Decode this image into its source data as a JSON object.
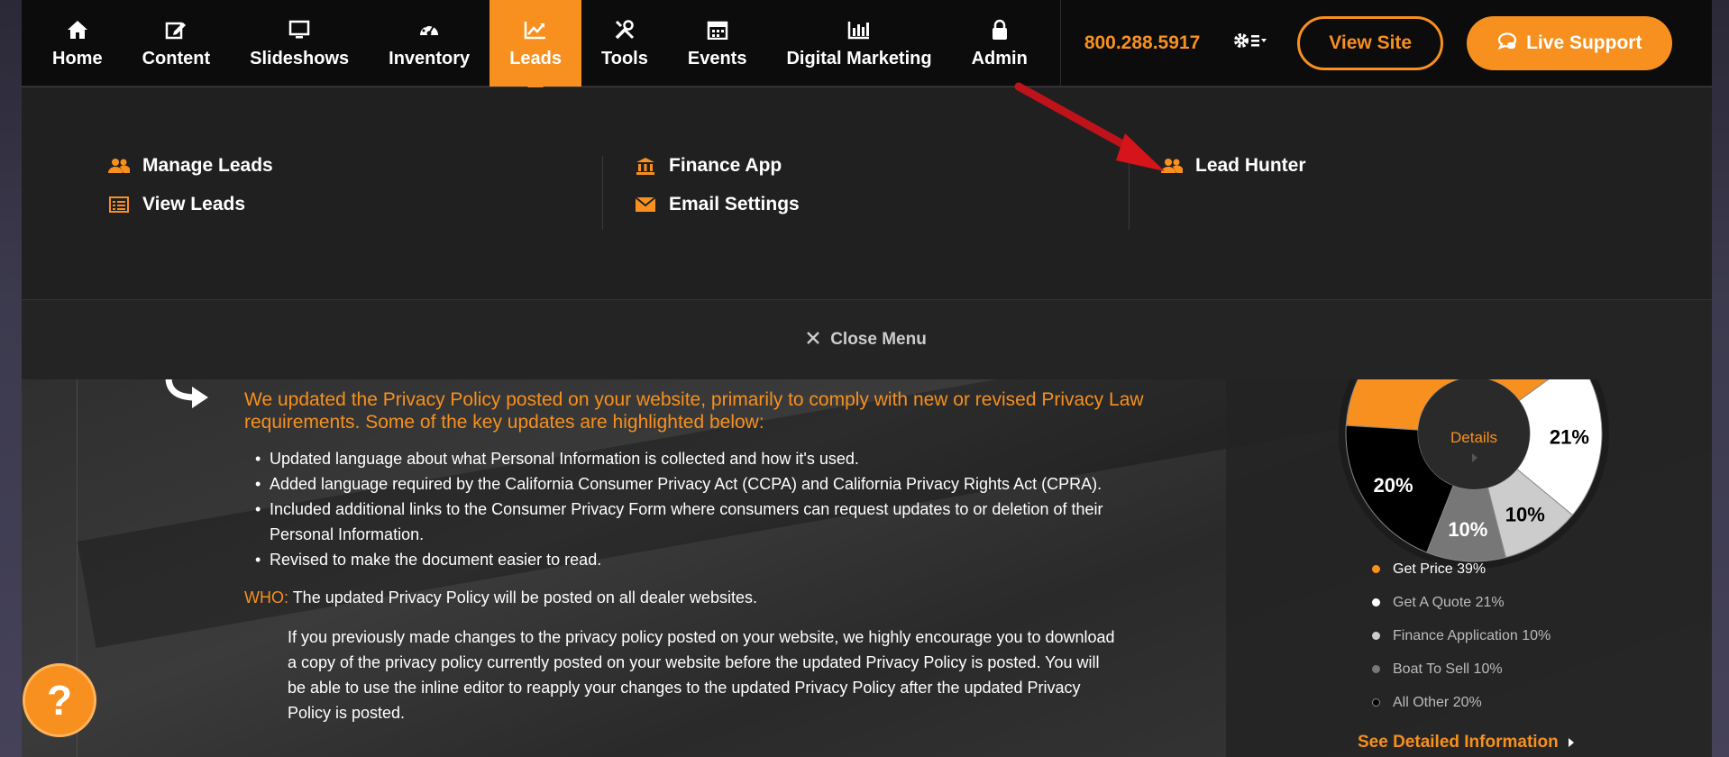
{
  "nav": {
    "items": [
      {
        "label": "Home",
        "icon": "home-icon"
      },
      {
        "label": "Content",
        "icon": "edit-icon"
      },
      {
        "label": "Slideshows",
        "icon": "monitor-icon"
      },
      {
        "label": "Inventory",
        "icon": "dashboard-icon"
      },
      {
        "label": "Leads",
        "icon": "chart-line-icon"
      },
      {
        "label": "Tools",
        "icon": "tools-icon"
      },
      {
        "label": "Events",
        "icon": "calendar-icon"
      },
      {
        "label": "Digital Marketing",
        "icon": "bar-chart-icon"
      },
      {
        "label": "Admin",
        "icon": "lock-icon"
      }
    ],
    "active": "Leads",
    "phone": "800.288.5917",
    "view_site": "View Site",
    "live_support": "Live Support"
  },
  "mega": {
    "col1": [
      {
        "label": "Manage Leads",
        "icon": "users-icon"
      },
      {
        "label": "View Leads",
        "icon": "list-icon"
      }
    ],
    "col2": [
      {
        "label": "Finance App",
        "icon": "bank-icon"
      },
      {
        "label": "Email Settings",
        "icon": "envelope-icon"
      }
    ],
    "col3": [
      {
        "label": "Lead Hunter",
        "icon": "users-icon"
      }
    ],
    "close": "Close Menu"
  },
  "article": {
    "headline": "We updated the Privacy Policy posted on your website, primarily to comply with new or revised Privacy Law requirements. Some of the key updates are highlighted below:",
    "bullets": [
      "Updated language about what Personal Information is collected and how it's used.",
      "Added language required by the California Consumer Privacy Act (CCPA) and California Privacy Rights Act (CPRA).",
      "Included additional links to the Consumer Privacy Form where consumers can request updates to or deletion of their Personal Information.",
      "Revised to make the document easier to read."
    ],
    "who_label": "WHO:",
    "who_text": "The updated Privacy Policy will be posted on all dealer websites.",
    "paragraph": "If you previously made changes to the privacy policy posted on your website, we highly encourage you to download a copy of the privacy policy currently posted on your website before the updated Privacy Policy is posted. You will be able to use the inline editor to reapply your changes to the updated Privacy Policy after the updated Privacy Policy is posted."
  },
  "chart_data": {
    "type": "pie",
    "categories": [
      "Get Price",
      "Get A Quote",
      "Finance Application",
      "Boat To Sell",
      "All Other"
    ],
    "values": [
      39,
      21,
      10,
      10,
      20
    ],
    "colors": [
      "#f7901e",
      "#ffffff",
      "#cccccc",
      "#777777",
      "#000000"
    ],
    "slice_labels": [
      "",
      "21%",
      "10%",
      "10%",
      "20%"
    ],
    "center_label": "Details",
    "legend": [
      "Get Price 39%",
      "Get A Quote 21%",
      "Finance Application 10%",
      "Boat To Sell 10%",
      "All Other 20%"
    ]
  },
  "see_more": "See Detailed Information",
  "help": "?"
}
